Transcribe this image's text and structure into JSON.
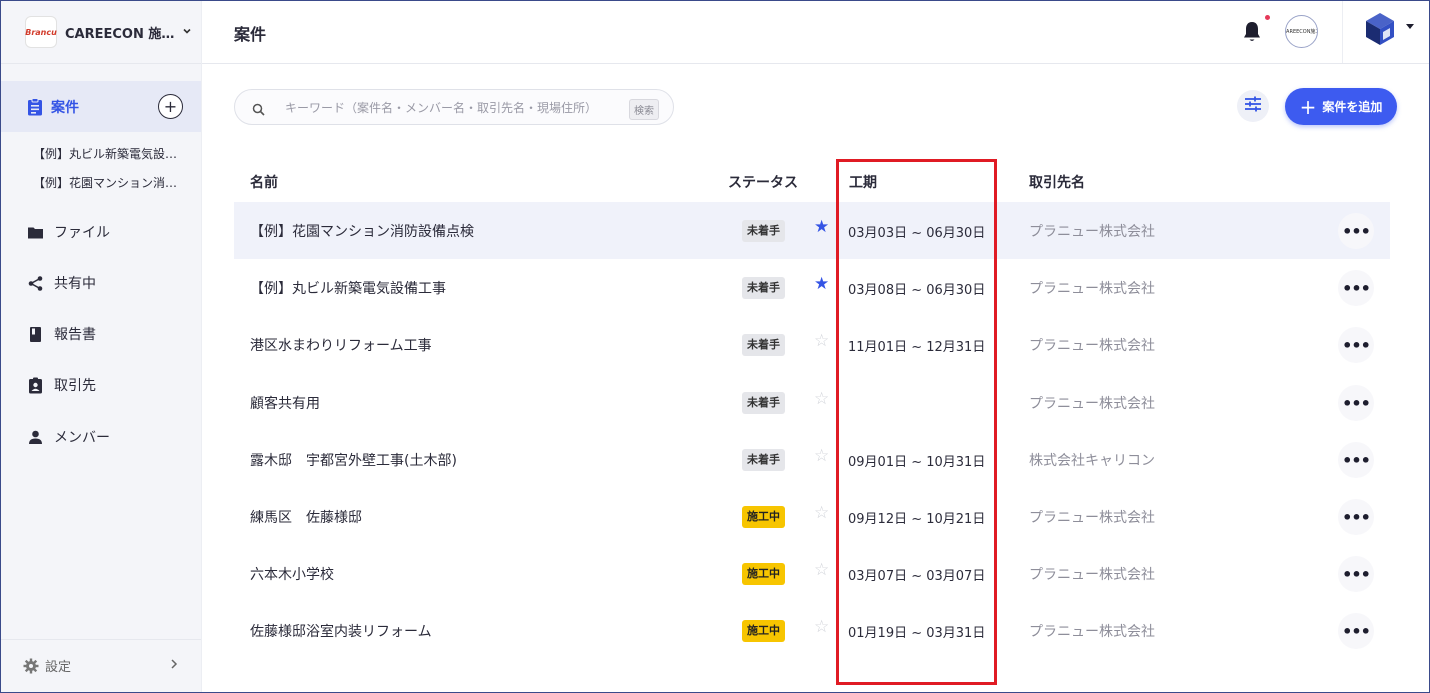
{
  "sidebar": {
    "org_logo_text": "Brancu",
    "org_name": "CAREECON 施…",
    "nav_active_label": "案件",
    "recent_projects": [
      "【例】丸ビル新築電気設…",
      "【例】花園マンション消…"
    ],
    "items": [
      {
        "label": "ファイル",
        "icon": "folder-icon"
      },
      {
        "label": "共有中",
        "icon": "share-icon"
      },
      {
        "label": "報告書",
        "icon": "book-icon"
      },
      {
        "label": "取引先",
        "icon": "contact-badge-icon"
      },
      {
        "label": "メンバー",
        "icon": "person-icon"
      }
    ],
    "settings_label": "設定"
  },
  "header": {
    "title": "案件",
    "org_avatar_text": "CAREECON施工"
  },
  "toolbar": {
    "search_placeholder": "キーワード（案件名・メンバー名・取引先名・現場住所）",
    "search_key_hint": "検索",
    "add_label": "案件を追加"
  },
  "table": {
    "headers": {
      "name": "名前",
      "status": "ステータス",
      "period": "工期",
      "client": "取引先名"
    },
    "rows": [
      {
        "name": "【例】花園マンション消防設備点検",
        "status": "未着手",
        "status_kind": "todo",
        "starred": true,
        "period": "03月03日 ~ 06月30日",
        "client": "プラニュー株式会社"
      },
      {
        "name": "【例】丸ビル新築電気設備工事",
        "status": "未着手",
        "status_kind": "todo",
        "starred": true,
        "period": "03月08日 ~ 06月30日",
        "client": "プラニュー株式会社"
      },
      {
        "name": "港区水まわりリフォーム工事",
        "status": "未着手",
        "status_kind": "todo",
        "starred": false,
        "period": "11月01日 ~ 12月31日",
        "client": "プラニュー株式会社"
      },
      {
        "name": "顧客共有用",
        "status": "未着手",
        "status_kind": "todo",
        "starred": false,
        "period": "",
        "client": "プラニュー株式会社"
      },
      {
        "name": "露木邸　宇都宮外壁工事(土木部)",
        "status": "未着手",
        "status_kind": "todo",
        "starred": false,
        "period": "09月01日 ~ 10月31日",
        "client": "株式会社キャリコン"
      },
      {
        "name": "練馬区　佐藤様邸",
        "status": "施工中",
        "status_kind": "doing",
        "starred": false,
        "period": "09月12日 ~ 10月21日",
        "client": "プラニュー株式会社"
      },
      {
        "name": "六本木小学校",
        "status": "施工中",
        "status_kind": "doing",
        "starred": false,
        "period": "03月07日 ~ 03月07日",
        "client": "プラニュー株式会社"
      },
      {
        "name": "佐藤様邸浴室内装リフォーム",
        "status": "施工中",
        "status_kind": "doing",
        "starred": false,
        "period": "01月19日 ~ 03月31日",
        "client": "プラニュー株式会社"
      }
    ]
  },
  "colors": {
    "accent": "#3454e5",
    "annotation": "#e01b24",
    "in_progress": "#f7c500"
  }
}
